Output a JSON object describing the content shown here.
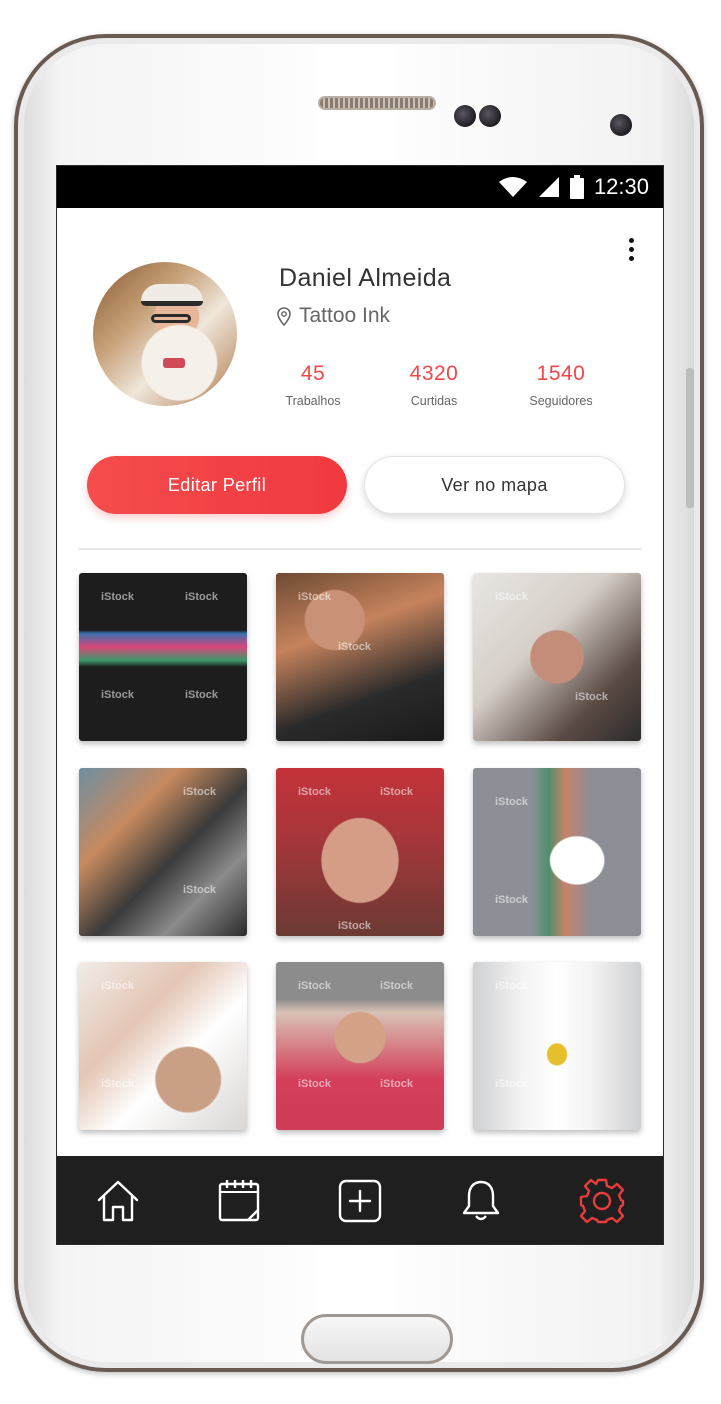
{
  "status_bar": {
    "time": "12:30",
    "icons": [
      "wifi-icon",
      "signal-icon",
      "battery-icon"
    ]
  },
  "profile": {
    "name": "Daniel Almeida",
    "location": "Tattoo Ink",
    "location_icon": "location-pin-icon",
    "menu_icon": "more-vert-icon"
  },
  "stats": [
    {
      "value": "45",
      "label": "Trabalhos"
    },
    {
      "value": "4320",
      "label": "Curtidas"
    },
    {
      "value": "1540",
      "label": "Seguidores"
    }
  ],
  "actions": {
    "edit_label": "Editar Perfil",
    "map_label": "Ver no mapa"
  },
  "gallery": {
    "watermark": "iStock",
    "items": [
      "tattoo-photo-1",
      "tattoo-photo-2",
      "tattoo-photo-3",
      "tattoo-photo-4",
      "tattoo-photo-5",
      "tattoo-photo-6",
      "tattoo-photo-7",
      "tattoo-photo-8",
      "tattoo-photo-9"
    ]
  },
  "bottom_nav": [
    {
      "icon": "home-icon",
      "active": false
    },
    {
      "icon": "calendar-icon",
      "active": false
    },
    {
      "icon": "add-icon",
      "active": false
    },
    {
      "icon": "bell-icon",
      "active": false
    },
    {
      "icon": "gear-icon",
      "active": true
    }
  ],
  "colors": {
    "accent": "#f04848",
    "nav_background": "#1f1f1f",
    "nav_icon": "#ffffff",
    "nav_active": "#e93c3c"
  }
}
